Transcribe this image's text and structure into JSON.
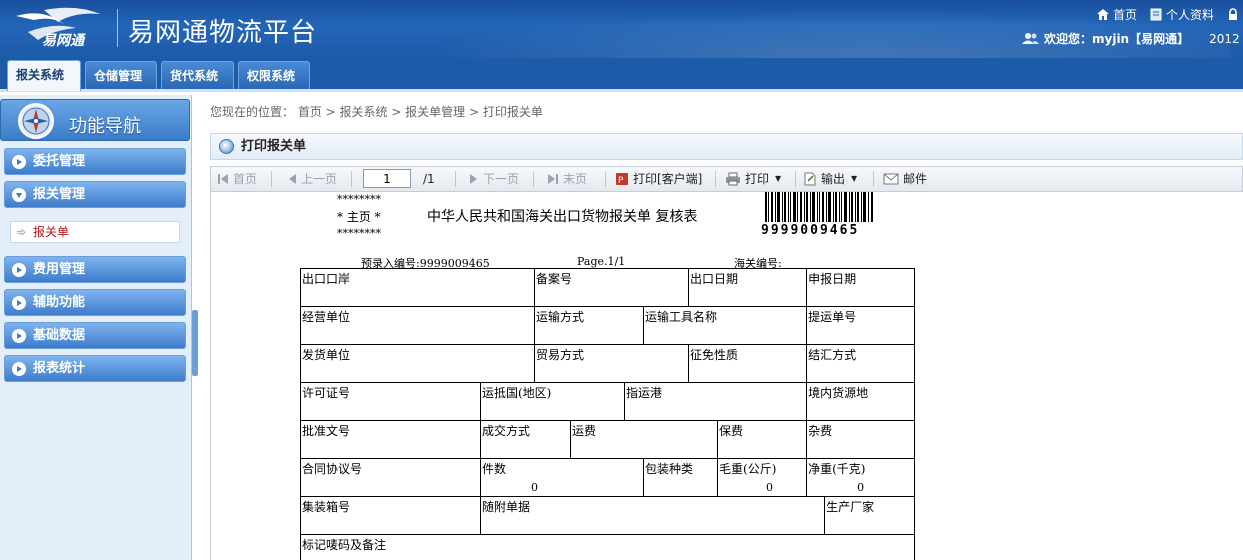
{
  "app": {
    "logo_text": "易网通",
    "title": "易网通物流平台"
  },
  "top_links": {
    "home": "首页",
    "profile": "个人资料",
    "welcome": "欢迎您：myjin【易网通】",
    "date": "2012"
  },
  "tabs": [
    {
      "label": "报关系统"
    },
    {
      "label": "仓储管理"
    },
    {
      "label": "货代系统"
    },
    {
      "label": "权限系统"
    }
  ],
  "sidebar": {
    "header": "功能导航",
    "items": [
      {
        "label": "委托管理"
      },
      {
        "label": "报关管理"
      },
      {
        "label": "费用管理"
      },
      {
        "label": "辅助功能"
      },
      {
        "label": "基础数据"
      },
      {
        "label": "报表统计"
      }
    ],
    "submenu": "报关单"
  },
  "breadcrumb": "您现在的位置： 首页 > 报关系统 > 报关单管理 > 打印报关单",
  "panel_title": "打印报关单",
  "toolbar": {
    "first": "首页",
    "prev": "上一页",
    "page_value": "1",
    "page_total": "/1",
    "next": "下一页",
    "last": "末页",
    "print_client": "打印[客户端]",
    "print": "打印",
    "export": "输出",
    "mail": "邮件"
  },
  "doc": {
    "stars_top": "********",
    "home_mark": "* 主页 *",
    "stars_bottom": "********",
    "title": "中华人民共和国海关出口货物报关单  复核表",
    "barcode": "9999009465",
    "entry_no": "预录入编号:9999009465",
    "page": "Page.1/1",
    "customs_no": "海关编号:",
    "fields": {
      "export_port": "出口口岸",
      "record_no": "备案号",
      "export_date": "出口日期",
      "declare_date": "申报日期",
      "operator": "经营单位",
      "transport_mode": "运输方式",
      "transport_tool": "运输工具名称",
      "bill_no": "提运单号",
      "shipper": "发货单位",
      "trade_mode": "贸易方式",
      "levy_nature": "征免性质",
      "settlement": "结汇方式",
      "license_no": "许可证号",
      "dest_country": "运抵国(地区)",
      "dest_port": "指运港",
      "domestic_source": "境内货源地",
      "approval_no": "批准文号",
      "deal_mode": "成交方式",
      "freight": "运费",
      "insurance": "保费",
      "misc_fee": "杂费",
      "contract_no": "合同协议号",
      "pieces": "件数",
      "pieces_value": "0",
      "packing": "包装种类",
      "gross_weight": "毛重(公斤)",
      "gross_weight_value": "0",
      "net_weight": "净重(千克)",
      "net_weight_value": "0",
      "container_no": "集装箱号",
      "attached_docs": "随附单据",
      "manufacturer": "生产厂家",
      "marks": "标记唛码及备注"
    }
  }
}
